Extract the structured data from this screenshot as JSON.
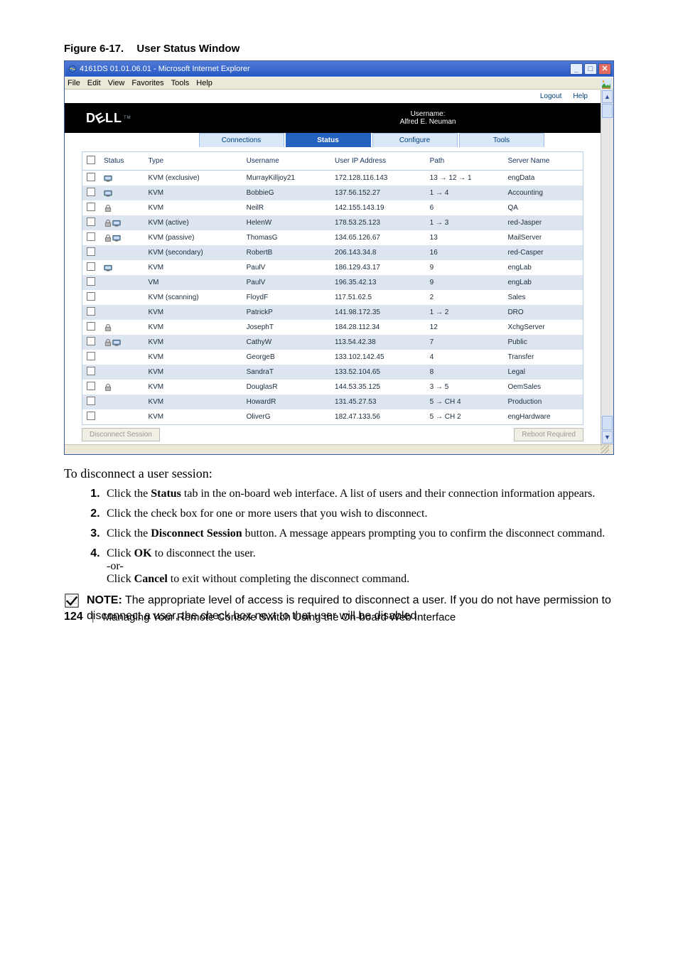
{
  "figure_heading": {
    "number": "Figure 6-17.",
    "title": "User Status Window"
  },
  "window": {
    "title": "4161DS 01.01.06.01 - Microsoft Internet Explorer",
    "menus": [
      "File",
      "Edit",
      "View",
      "Favorites",
      "Tools",
      "Help"
    ],
    "scrollbar_up_glyph": "▲",
    "scrollbar_down_glyph": "▼"
  },
  "page": {
    "topbar": {
      "logout": "Logout",
      "help": "Help"
    },
    "username_label": "Username:",
    "username_value": "Alfred E. Neuman",
    "tabs": [
      "Connections",
      "Status",
      "Configure",
      "Tools"
    ],
    "active_tab_index": 1
  },
  "table": {
    "columns": [
      "",
      "Status",
      "Type",
      "Username",
      "User IP Address",
      "Path",
      "Server Name"
    ],
    "rows": [
      {
        "stripe": false,
        "lock": false,
        "kvm": true,
        "type": "KVM (exclusive)",
        "user": "MurrayKilljoy21",
        "ip": "172.128.116.143",
        "path": "13 → 12 → 1",
        "server": "engData"
      },
      {
        "stripe": true,
        "lock": false,
        "kvm": true,
        "type": "KVM",
        "user": "BobbieG",
        "ip": "137.56.152.27",
        "path": "1 → 4",
        "server": "Accounting"
      },
      {
        "stripe": false,
        "lock": true,
        "kvm": false,
        "type": "KVM",
        "user": "NeilR",
        "ip": "142.155.143.19",
        "path": "6",
        "server": "QA"
      },
      {
        "stripe": true,
        "lock": true,
        "kvm": true,
        "type": "KVM (active)",
        "user": "HelenW",
        "ip": "178.53.25.123",
        "path": "1 → 3",
        "server": "red-Jasper"
      },
      {
        "stripe": false,
        "lock": true,
        "kvm": true,
        "type": "KVM (passive)",
        "user": "ThomasG",
        "ip": "134.65.126.67",
        "path": "13",
        "server": "MailServer"
      },
      {
        "stripe": true,
        "lock": false,
        "kvm": false,
        "type": "KVM (secondary)",
        "user": "RobertB",
        "ip": "206.143.34.8",
        "path": "16",
        "server": "red-Casper"
      },
      {
        "stripe": false,
        "lock": false,
        "kvm": true,
        "type": "KVM",
        "user": "PaulV",
        "ip": "186.129.43.17",
        "path": "9",
        "server": "engLab"
      },
      {
        "stripe": true,
        "lock": false,
        "kvm": false,
        "type": "VM",
        "user": "PaulV",
        "ip": "196.35.42.13",
        "path": "9",
        "server": "engLab"
      },
      {
        "stripe": false,
        "lock": false,
        "kvm": false,
        "type": "KVM (scanning)",
        "user": "FloydF",
        "ip": "117.51.62.5",
        "path": "2",
        "server": "Sales"
      },
      {
        "stripe": true,
        "lock": false,
        "kvm": false,
        "type": "KVM",
        "user": "PatrickP",
        "ip": "141.98.172.35",
        "path": "1 → 2",
        "server": "DRO"
      },
      {
        "stripe": false,
        "lock": true,
        "kvm": false,
        "type": "KVM",
        "user": "JosephT",
        "ip": "184.28.112.34",
        "path": "12",
        "server": "XchgServer"
      },
      {
        "stripe": true,
        "lock": true,
        "kvm": true,
        "type": "KVM",
        "user": "CathyW",
        "ip": "113.54.42.38",
        "path": "7",
        "server": "Public"
      },
      {
        "stripe": false,
        "lock": false,
        "kvm": false,
        "type": "KVM",
        "user": "GeorgeB",
        "ip": "133.102.142.45",
        "path": "4",
        "server": "Transfer"
      },
      {
        "stripe": true,
        "lock": false,
        "kvm": false,
        "type": "KVM",
        "user": "SandraT",
        "ip": "133.52.104.65",
        "path": "8",
        "server": "Legal"
      },
      {
        "stripe": false,
        "lock": true,
        "kvm": false,
        "type": "KVM",
        "user": "DouglasR",
        "ip": "144.53.35.125",
        "path": "3 → 5",
        "server": "OemSales"
      },
      {
        "stripe": true,
        "lock": false,
        "kvm": false,
        "type": "KVM",
        "user": "HowardR",
        "ip": "131.45.27.53",
        "path": "5 → CH 4",
        "server": "Production"
      },
      {
        "stripe": false,
        "lock": false,
        "kvm": false,
        "type": "KVM",
        "user": "OliverG",
        "ip": "182.47.133.56",
        "path": "5 → CH 2",
        "server": "engHardware"
      }
    ],
    "buttons": {
      "disconnect": "Disconnect Session",
      "reboot": "Reboot Required"
    }
  },
  "narrative": {
    "intro": "To disconnect a user session:",
    "steps": [
      {
        "prefix": "Click the ",
        "bold": "Status",
        "suffix": " tab in the on-board web interface. A list of users and their connection information appears."
      },
      {
        "prefix": "Click the check box for one or more users that you wish to disconnect.",
        "bold": "",
        "suffix": ""
      },
      {
        "prefix": "Click the ",
        "bold": "Disconnect Session",
        "suffix": " button. A message appears prompting you to confirm the disconnect command."
      },
      {
        "prefix": "Click ",
        "bold": "OK",
        "suffix": " to disconnect the user."
      }
    ],
    "or": "-or-",
    "or_line_prefix": "Click ",
    "or_line_bold": "Cancel",
    "or_line_suffix": " to exit without completing the disconnect command.",
    "note_lead": "NOTE:",
    "note_body": " The appropriate level of access is required to disconnect a user. If you do not have permission to disconnect a user, the check box next to that user will be disabled."
  },
  "footer": {
    "page_number": "124",
    "section_title": "Managing Your Remote Console Switch Using the On-board Web Interface"
  }
}
